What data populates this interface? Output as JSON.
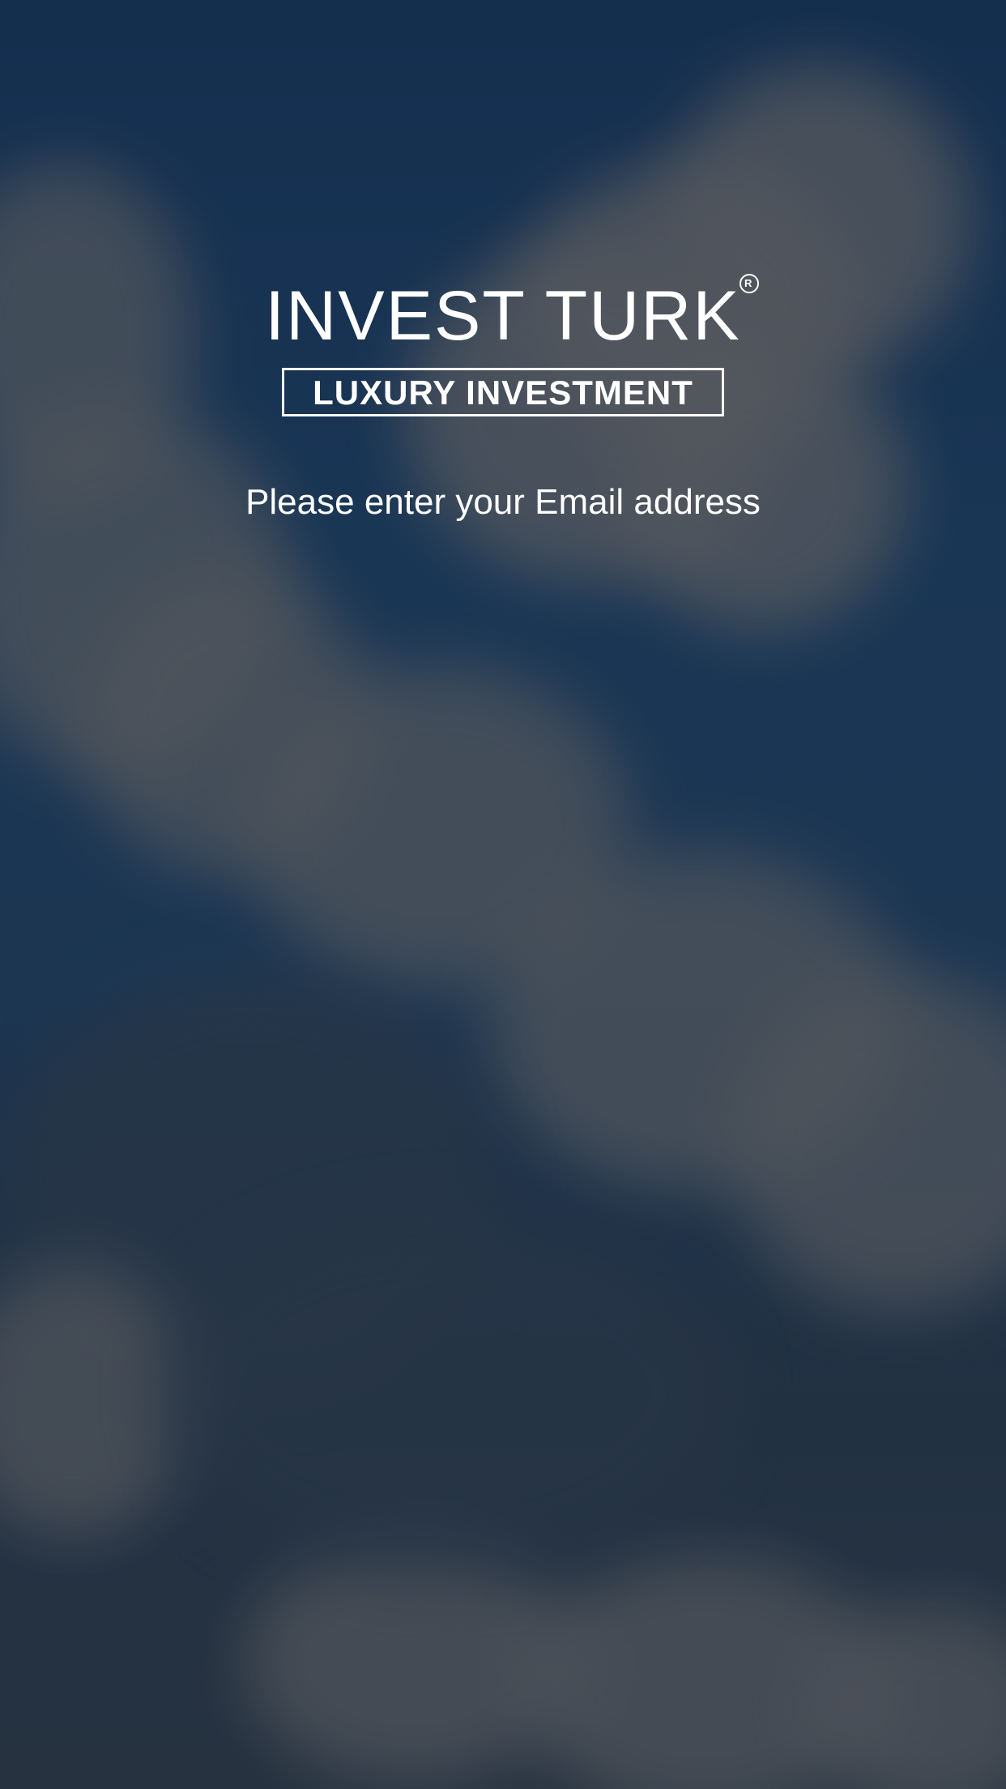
{
  "background": {
    "description_icon": "cloud-sky-background",
    "colors": {
      "sky": "#1b3a5b",
      "cloud": "#5a5e63"
    }
  },
  "logo": {
    "brand_name": "INVEST TURK",
    "registered_mark": "R",
    "tagline": "LUXURY INVESTMENT"
  },
  "prompt": {
    "text": "Please enter your Email address"
  }
}
